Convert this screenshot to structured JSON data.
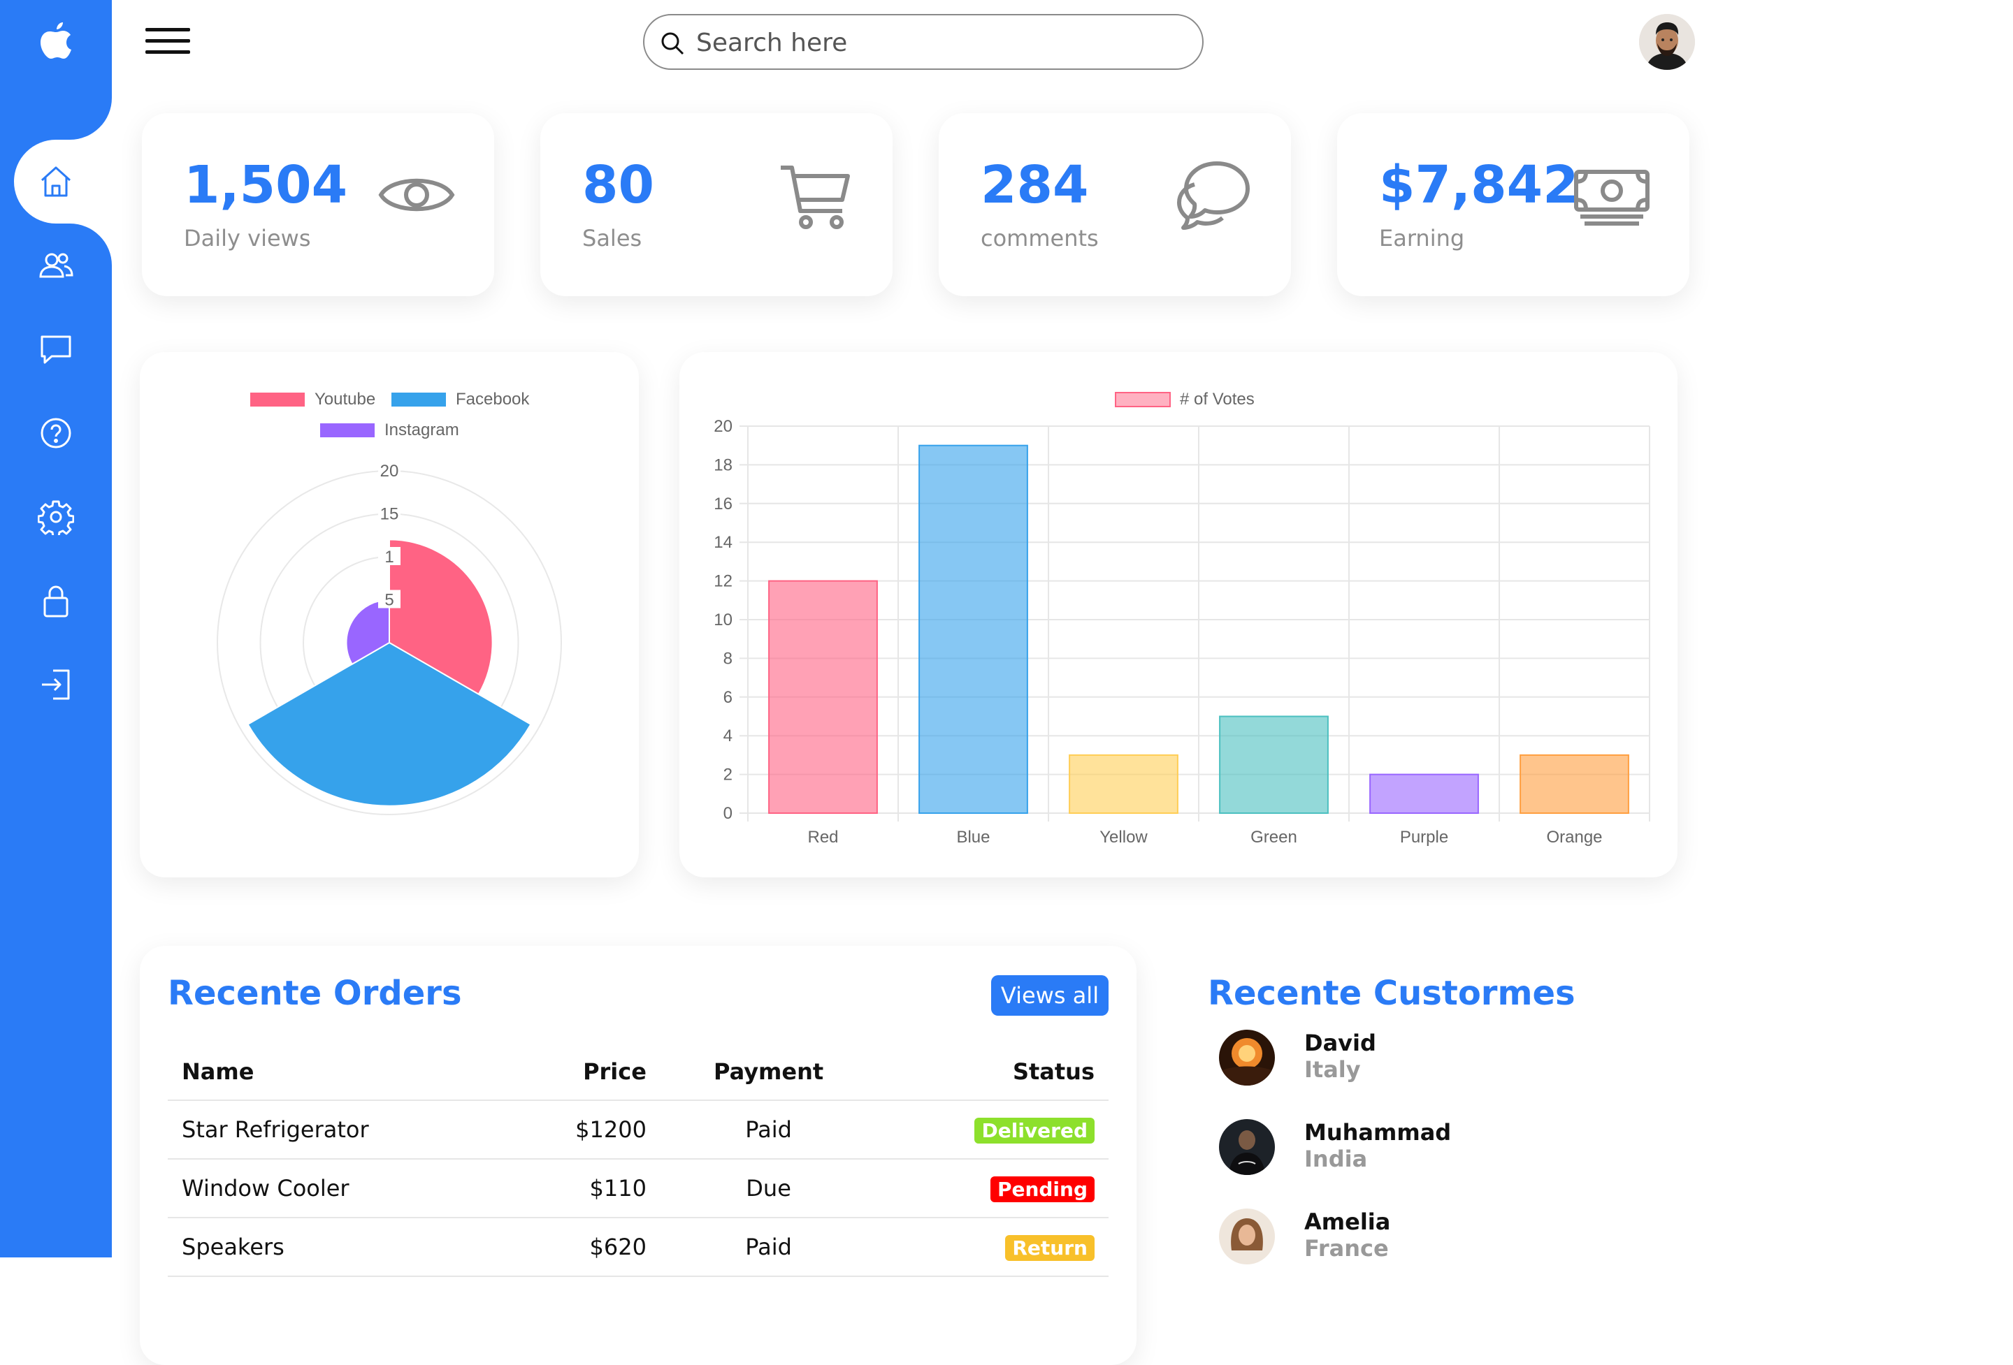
{
  "topbar": {
    "search_placeholder": "Search here"
  },
  "sidebar": {
    "items": [
      {
        "icon": "home-icon",
        "active": true
      },
      {
        "icon": "users-icon"
      },
      {
        "icon": "message-icon"
      },
      {
        "icon": "help-icon"
      },
      {
        "icon": "settings-icon"
      },
      {
        "icon": "lock-icon"
      },
      {
        "icon": "sign-out-icon"
      }
    ]
  },
  "cards": [
    {
      "number": "1,504",
      "label": "Daily views",
      "icon": "eye-icon"
    },
    {
      "number": "80",
      "label": "Sales",
      "icon": "cart-icon"
    },
    {
      "number": "284",
      "label": "comments",
      "icon": "chat-icon"
    },
    {
      "number": "$7,842",
      "label": "Earning",
      "icon": "cash-icon"
    }
  ],
  "colors": {
    "accent": "#2a7bf6",
    "delivered": "#8de02c",
    "pending": "#f00",
    "return": "#f8c02a"
  },
  "chart_data": [
    {
      "type": "polarArea",
      "legend": [
        "Youtube",
        "Facebook",
        "Instagram"
      ],
      "legend_colors": [
        "#ff6384",
        "#36a2eb",
        "#9966ff"
      ],
      "values": [
        12,
        19,
        5
      ],
      "r_ticks": [
        "20",
        "15",
        "1",
        "5"
      ],
      "r_max": 20,
      "legend_position": "top"
    },
    {
      "type": "bar",
      "series_name": "# of Votes",
      "categories": [
        "Red",
        "Blue",
        "Yellow",
        "Green",
        "Purple",
        "Orange"
      ],
      "values": [
        12,
        19,
        3,
        5,
        2,
        3
      ],
      "ylim": [
        0,
        20
      ],
      "yticks": [
        "0",
        "2",
        "4",
        "6",
        "8",
        "10",
        "12",
        "14",
        "16",
        "18",
        "20"
      ],
      "fill_colors": [
        "rgba(255,99,132,0.6)",
        "rgba(54,162,235,0.6)",
        "rgba(255,206,86,0.6)",
        "rgba(75,192,192,0.6)",
        "rgba(153,102,255,0.6)",
        "rgba(255,159,64,0.6)"
      ],
      "border_colors": [
        "#ff6384",
        "#36a2eb",
        "#ffce56",
        "#4bc0c0",
        "#9966ff",
        "#ff9f40"
      ],
      "legend_position": "top",
      "grid": true
    }
  ],
  "orders": {
    "title": "Recente Orders",
    "view_all": "Views all",
    "headers": [
      "Name",
      "Price",
      "Payment",
      "Status"
    ],
    "rows": [
      {
        "name": "Star Refrigerator",
        "price": "$1200",
        "payment": "Paid",
        "status": "Delivered",
        "status_color": "#8de02c"
      },
      {
        "name": "Window Cooler",
        "price": "$110",
        "payment": "Due",
        "status": "Pending",
        "status_color": "#f00"
      },
      {
        "name": "Speakers",
        "price": "$620",
        "payment": "Paid",
        "status": "Return",
        "status_color": "#f8c02a"
      }
    ]
  },
  "customers": {
    "title": "Recente Custormes",
    "list": [
      {
        "name": "David",
        "country": "Italy"
      },
      {
        "name": "Muhammad",
        "country": "India"
      },
      {
        "name": "Amelia",
        "country": "France"
      }
    ]
  }
}
